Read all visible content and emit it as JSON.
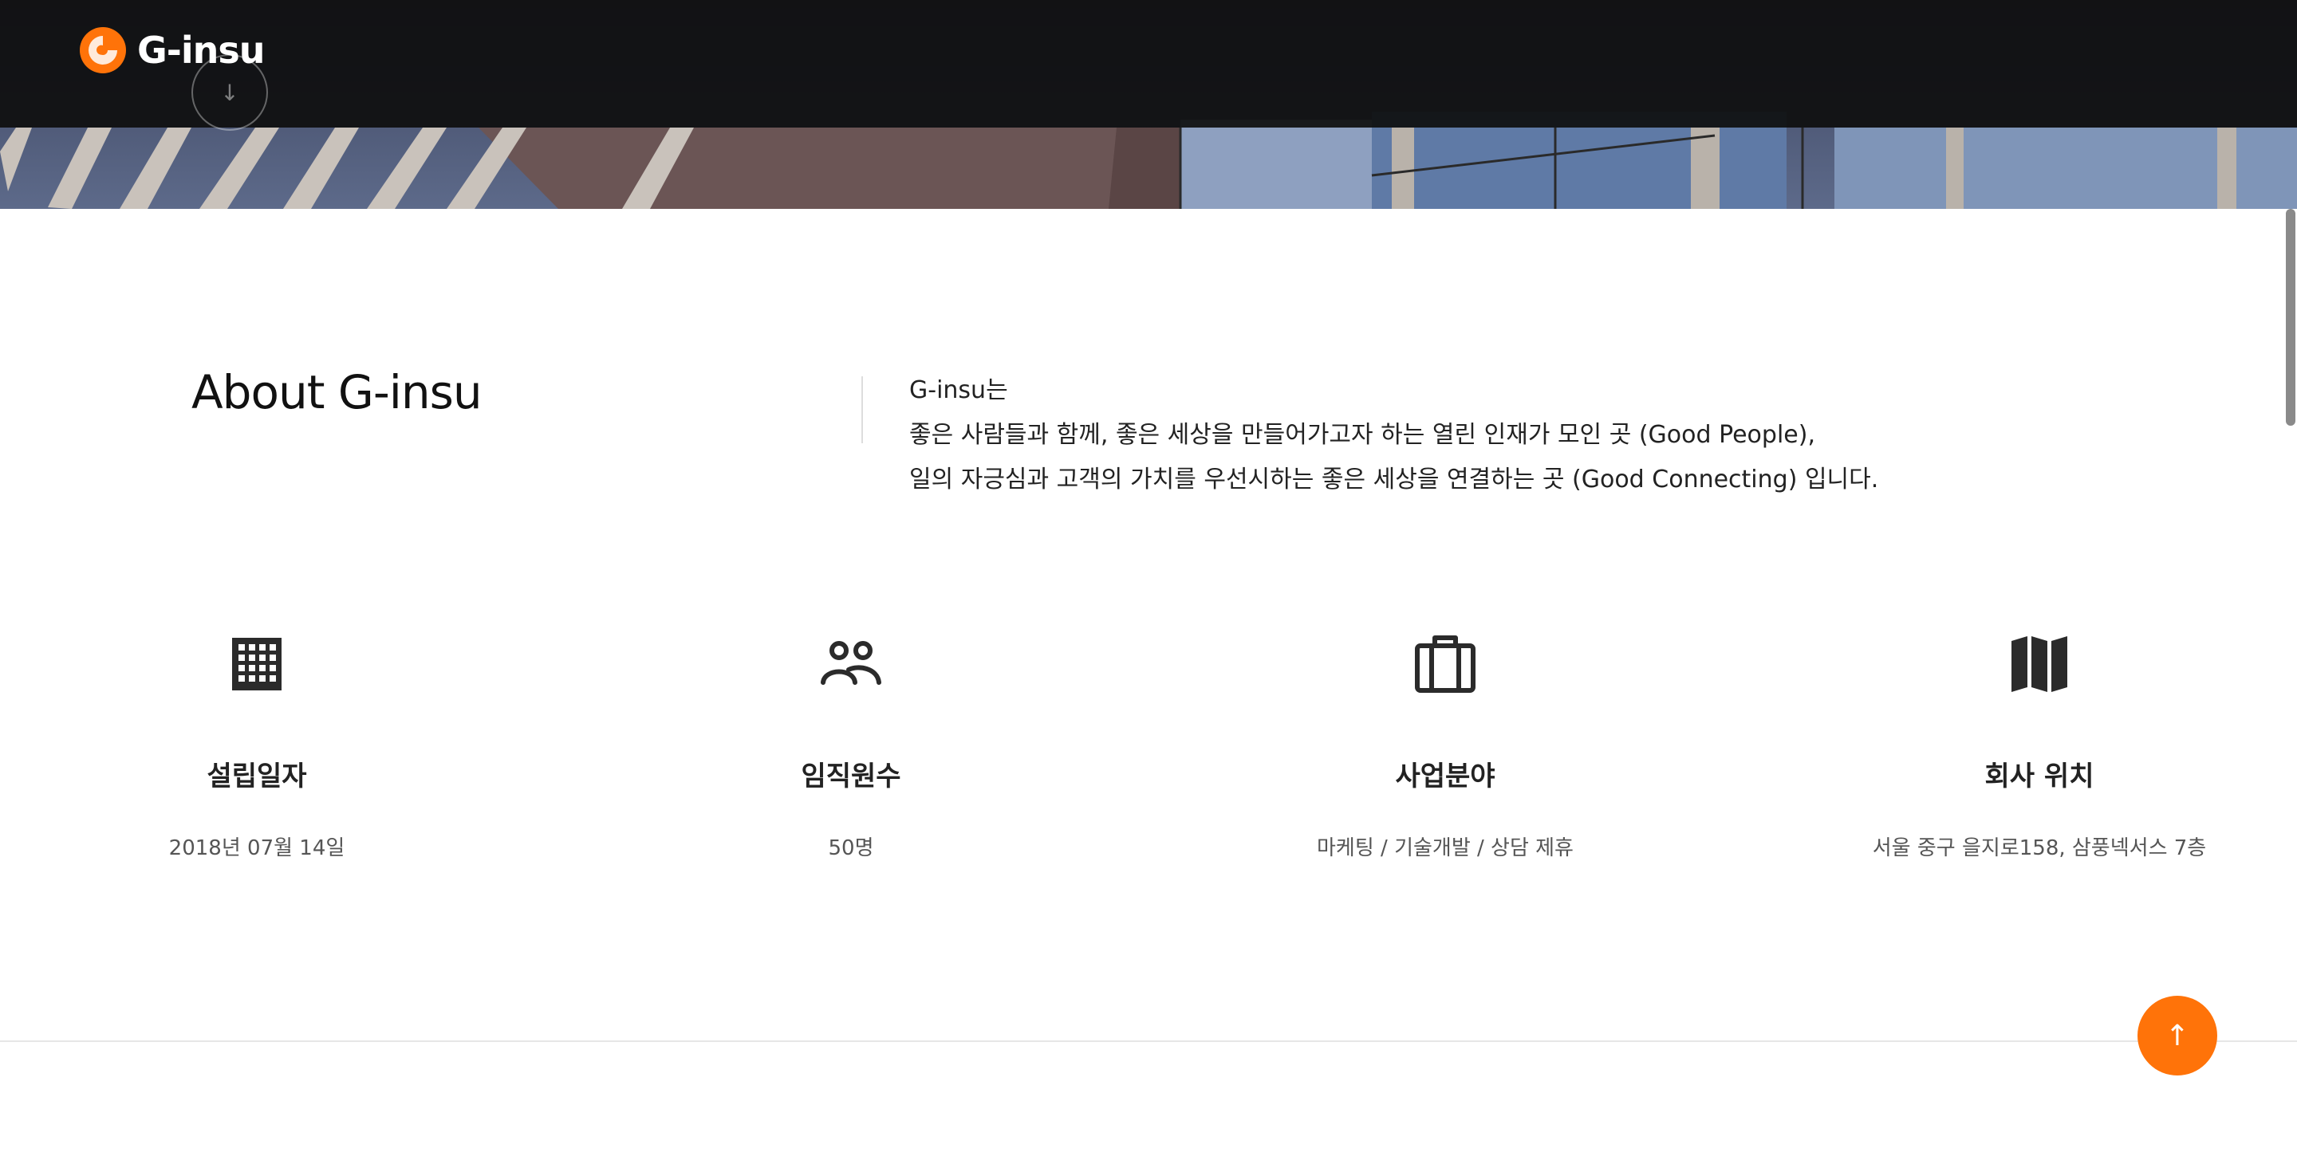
{
  "header": {
    "logo_text": "G-insu",
    "brand_color": "#ff7309",
    "scroll_down_icon": "arrow-down-icon"
  },
  "about": {
    "title": "About G-insu",
    "lines": [
      "G-insu는",
      "좋은 사람들과 함께, 좋은 세상을 만들어가고자 하는 열린 인재가 모인 곳 (Good People),",
      "일의 자긍심과 고객의 가치를 우선시하는 좋은 세상을 연결하는 곳 (Good Connecting) 입니다."
    ]
  },
  "features": [
    {
      "icon": "building-icon",
      "title": "설립일자",
      "value": "2018년 07월 14일"
    },
    {
      "icon": "people-icon",
      "title": "임직원수",
      "value": "50명"
    },
    {
      "icon": "briefcase-icon",
      "title": "사업분야",
      "value": "마케팅 / 기술개발 / 상담 제휴"
    },
    {
      "icon": "map-icon",
      "title": "회사 위치",
      "value": "서울 중구 을지로158, 삼풍넥서스 7층"
    }
  ],
  "scroll_top": {
    "icon": "arrow-up-icon",
    "color": "#ff7309"
  }
}
